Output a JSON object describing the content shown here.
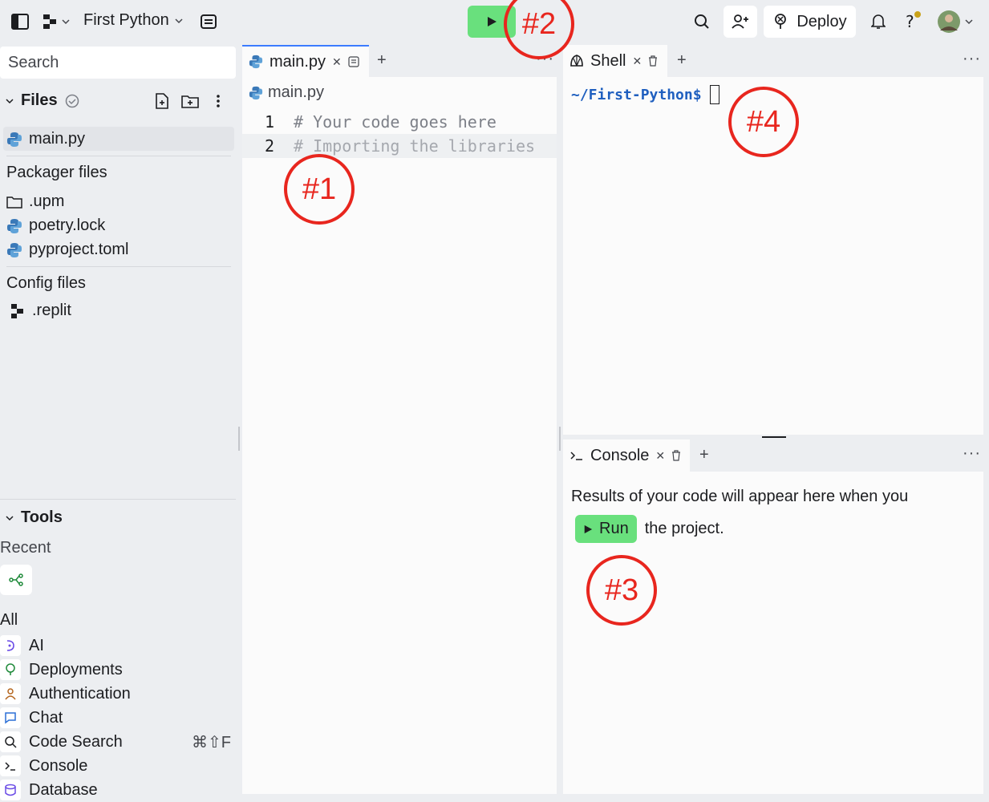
{
  "header": {
    "project_name": "First Python",
    "deploy_label": "Deploy"
  },
  "sidebar": {
    "search_placeholder": "Search",
    "files_title": "Files",
    "main_file": "main.py",
    "packager_title": "Packager files",
    "packager_items": [
      ".upm",
      "poetry.lock",
      "pyproject.toml"
    ],
    "config_title": "Config files",
    "config_items": [
      ".replit"
    ],
    "tools_title": "Tools",
    "recent_label": "Recent",
    "all_label": "All",
    "tools": [
      {
        "label": "AI",
        "shortcut": ""
      },
      {
        "label": "Deployments",
        "shortcut": ""
      },
      {
        "label": "Authentication",
        "shortcut": ""
      },
      {
        "label": "Chat",
        "shortcut": ""
      },
      {
        "label": "Code Search",
        "shortcut": "⌘⇧F"
      },
      {
        "label": "Console",
        "shortcut": ""
      },
      {
        "label": "Database",
        "shortcut": ""
      }
    ]
  },
  "editor": {
    "tab_label": "main.py",
    "breadcrumb": "main.py",
    "lines": [
      {
        "num": "1",
        "text": "# Your code goes here"
      },
      {
        "num": "2",
        "text": "# Importing the libraries"
      }
    ]
  },
  "shell": {
    "tab_label": "Shell",
    "prompt": "~/First-Python$"
  },
  "console": {
    "tab_label": "Console",
    "message": "Results of your code will appear here when you",
    "run_label": "Run",
    "message_tail": "the project."
  },
  "annotations": [
    "#1",
    "#2",
    "#3",
    "#4"
  ],
  "colors": {
    "run_green": "#69e07d",
    "annotation_red": "#e8261e",
    "accent_blue": "#3c7bff",
    "prompt_blue": "#1f5fbf"
  }
}
